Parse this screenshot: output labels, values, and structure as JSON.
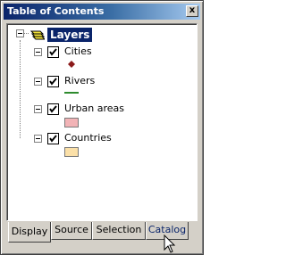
{
  "window": {
    "title": "Table of Contents",
    "close_label": "x"
  },
  "tree": {
    "root_label": "Layers",
    "layers": [
      {
        "name": "Cities",
        "checked": true,
        "symbol": "point",
        "symbol_color": "#8b1a1a"
      },
      {
        "name": "Rivers",
        "checked": true,
        "symbol": "line",
        "symbol_color": "#2e8b2e"
      },
      {
        "name": "Urban areas",
        "checked": true,
        "symbol": "polygon",
        "symbol_color": "#f2b3b6"
      },
      {
        "name": "Countries",
        "checked": true,
        "symbol": "polygon",
        "symbol_color": "#fbe0a8"
      }
    ]
  },
  "tabs": {
    "items": [
      "Display",
      "Source",
      "Selection",
      "Catalog"
    ],
    "active": "Display"
  },
  "colors": {
    "title_bar": "#0a246a",
    "selection_highlight": "#0a246a",
    "window_face": "#d4d0c8"
  }
}
